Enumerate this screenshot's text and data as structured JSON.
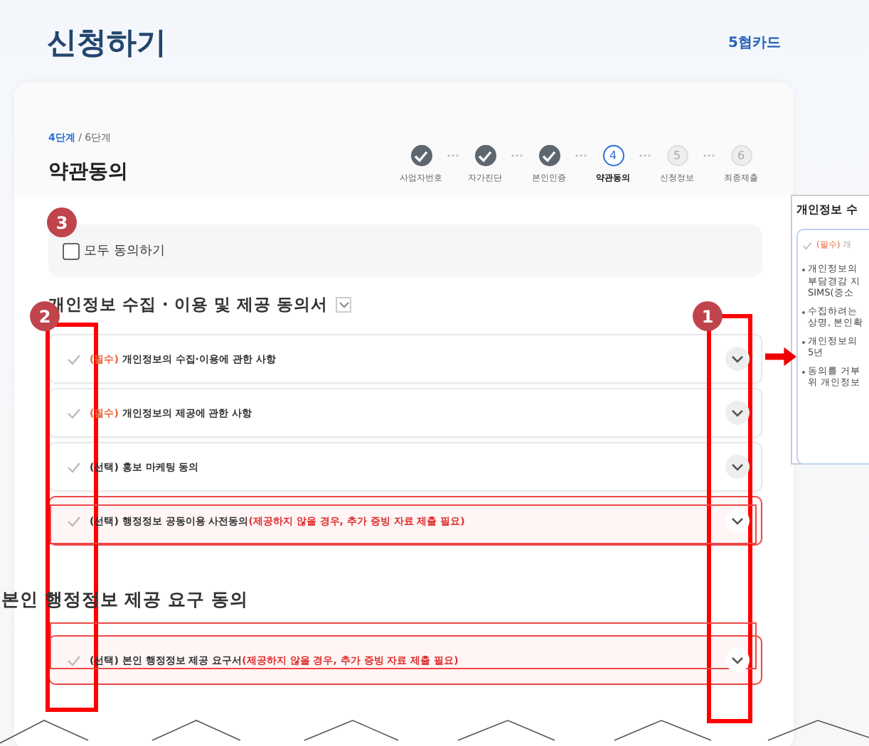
{
  "page_title": "신청하기",
  "logo": "5협카드",
  "step_progress": {
    "current": "4단계",
    "total": "/ 6단계"
  },
  "section_title": "약관동의",
  "steps": [
    {
      "label": "사업자번호",
      "done": true,
      "current": false
    },
    {
      "label": "자가진단",
      "done": true,
      "current": false
    },
    {
      "label": "본인인증",
      "done": true,
      "current": false
    },
    {
      "number": "4",
      "label": "약관동의",
      "done": false,
      "current": true
    },
    {
      "number": "5",
      "label": "신청정보",
      "done": false,
      "current": false
    },
    {
      "number": "6",
      "label": "최종제출",
      "done": false,
      "current": false
    }
  ],
  "agree_all": {
    "label": "모두 동의하기",
    "checked": false
  },
  "groups": [
    {
      "title": "개인정보 수집 · 이용 및 제공 동의서",
      "has_toggle": true,
      "items": [
        {
          "tag": "(필수)",
          "required": true,
          "text": "개인정보의 수집·이용에 관한 사항",
          "highlighted": false
        },
        {
          "tag": "(필수)",
          "required": true,
          "text": "개인정보의 제공에 관한 사항",
          "highlighted": false
        },
        {
          "tag": "(선택)",
          "required": false,
          "text": "홍보 마케팅 동의",
          "highlighted": false
        },
        {
          "tag": "(선택)",
          "required": false,
          "text": "행정정보 공동이용 사전동의",
          "warning": "(제공하지 않을 경우, 추가 증빙 자료 제출 필요)",
          "highlighted": true
        }
      ]
    },
    {
      "title": "본인 행정정보 제공 요구 동의",
      "items": [
        {
          "tag": "(선택)",
          "required": false,
          "text": "본인 행정정보 제공 요구서",
          "warning": "(제공하지 않을 경우, 추가 증빙 자료 제출 필요)",
          "highlighted": true
        }
      ]
    }
  ],
  "detail_panel": {
    "title": "개인정보 수",
    "item_tag": "(필수)",
    "item_text": "개",
    "bullets": [
      {
        "lines": [
          "개인정보의",
          "부담경감 지",
          "SIMS(중소"
        ]
      },
      {
        "lines": [
          "수집하려는",
          "상명, 본인확"
        ]
      },
      {
        "lines": [
          "개인정보의",
          "5년"
        ]
      },
      {
        "lines": [
          "동의를 거부",
          "위 개인정보"
        ]
      }
    ]
  },
  "annotations": [
    {
      "number": "1"
    },
    {
      "number": "2"
    },
    {
      "number": "3"
    }
  ]
}
